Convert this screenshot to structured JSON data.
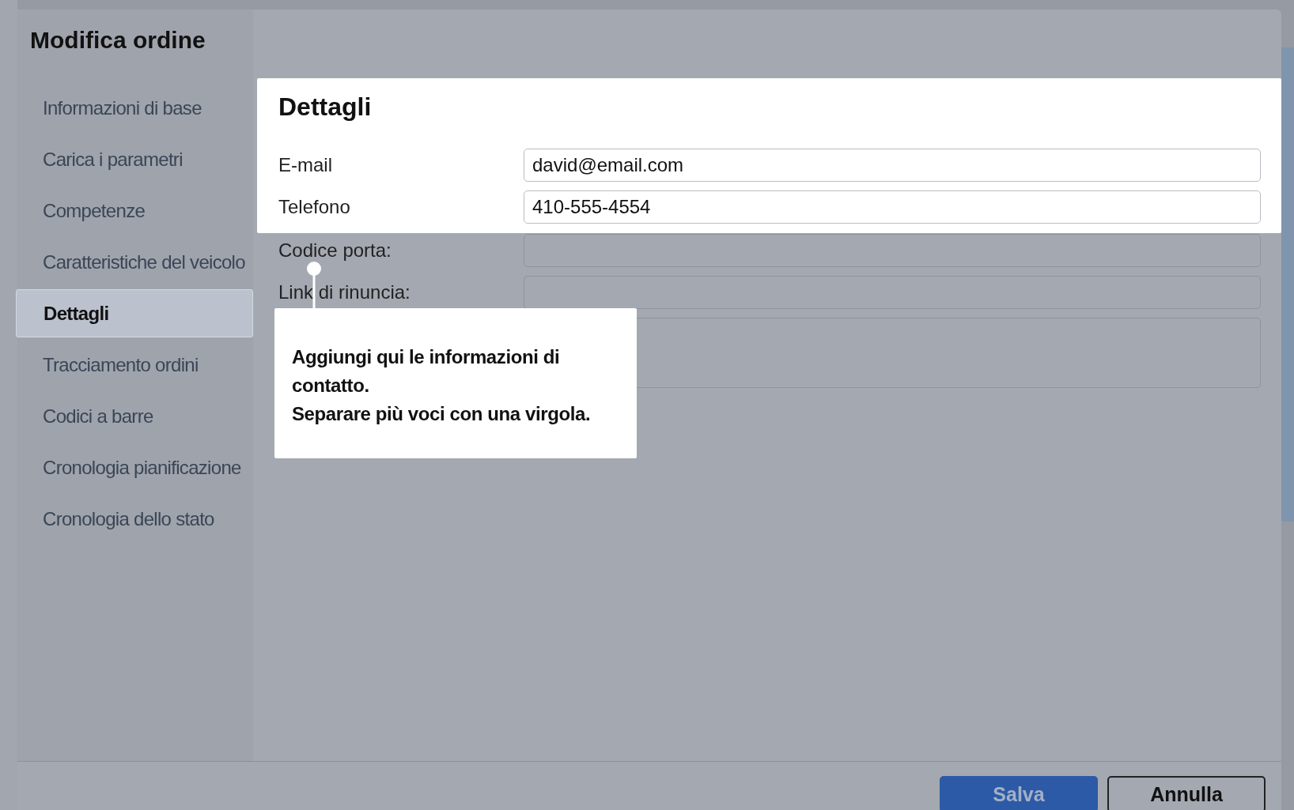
{
  "dialog": {
    "title": "Modifica ordine"
  },
  "sidebar": {
    "items": [
      {
        "label": "Informazioni di base",
        "selected": false
      },
      {
        "label": "Carica i parametri",
        "selected": false
      },
      {
        "label": "Competenze",
        "selected": false
      },
      {
        "label": "Caratteristiche del veicolo",
        "selected": false
      },
      {
        "label": "Dettagli",
        "selected": true
      },
      {
        "label": "Tracciamento ordini",
        "selected": false
      },
      {
        "label": "Codici a barre",
        "selected": false
      },
      {
        "label": "Cronologia pianificazione",
        "selected": false
      },
      {
        "label": "Cronologia dello stato",
        "selected": false
      }
    ]
  },
  "section": {
    "title": "Dettagli"
  },
  "fields": [
    {
      "kind": "input",
      "label": "E-mail",
      "value": "david@email.com",
      "highlighted": true
    },
    {
      "kind": "input",
      "label": "Telefono",
      "value": "410-555-4554",
      "highlighted": true
    },
    {
      "kind": "input",
      "label": "Codice porta:",
      "highlighted": false
    },
    {
      "kind": "input",
      "label": "Link di rinuncia:",
      "highlighted": false
    },
    {
      "kind": "textarea",
      "highlighted": false
    }
  ],
  "tooltip": {
    "lines": [
      "Aggiungi qui le informazioni di contatto.",
      "Separare più voci con una virgola."
    ]
  },
  "buttons": [
    {
      "label": "Salva",
      "kind": "primary"
    },
    {
      "label": "Annulla",
      "kind": "secondary"
    }
  ]
}
